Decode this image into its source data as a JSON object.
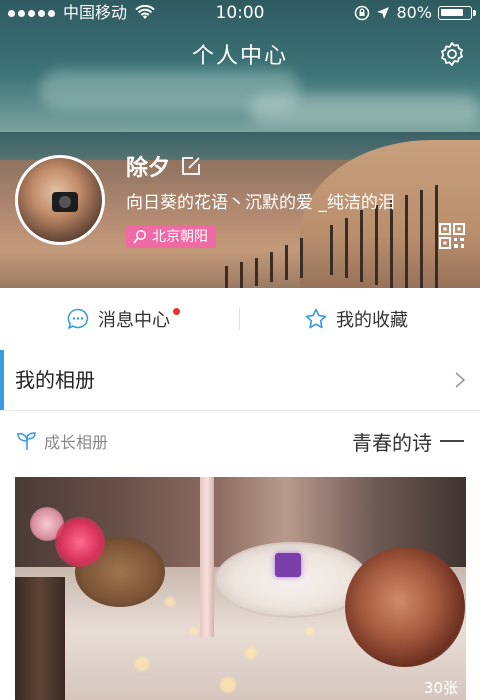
{
  "status_bar": {
    "carrier": "中国移动",
    "time": "10:00",
    "battery": "80%",
    "battery_level": 0.8
  },
  "header": {
    "title": "个人中心",
    "settings_icon": "gear-icon"
  },
  "profile": {
    "name": "除夕",
    "signature": "向日葵的花语丶沉默的爱 _纯洁的泪",
    "location": "北京朝阳"
  },
  "tabs": [
    {
      "label": "消息中心",
      "icon": "chat-bubble-icon",
      "unread": true
    },
    {
      "label": "我的收藏",
      "icon": "star-icon",
      "unread": false
    }
  ],
  "album_section": {
    "title": "我的相册"
  },
  "growth_album": {
    "label": "成长相册",
    "poem_title": "青春的诗"
  },
  "photo": {
    "count": "30张"
  },
  "colors": {
    "accent_blue": "#3b9be0",
    "location_badge": "#f06aa6",
    "unread_dot": "#e8322d"
  }
}
